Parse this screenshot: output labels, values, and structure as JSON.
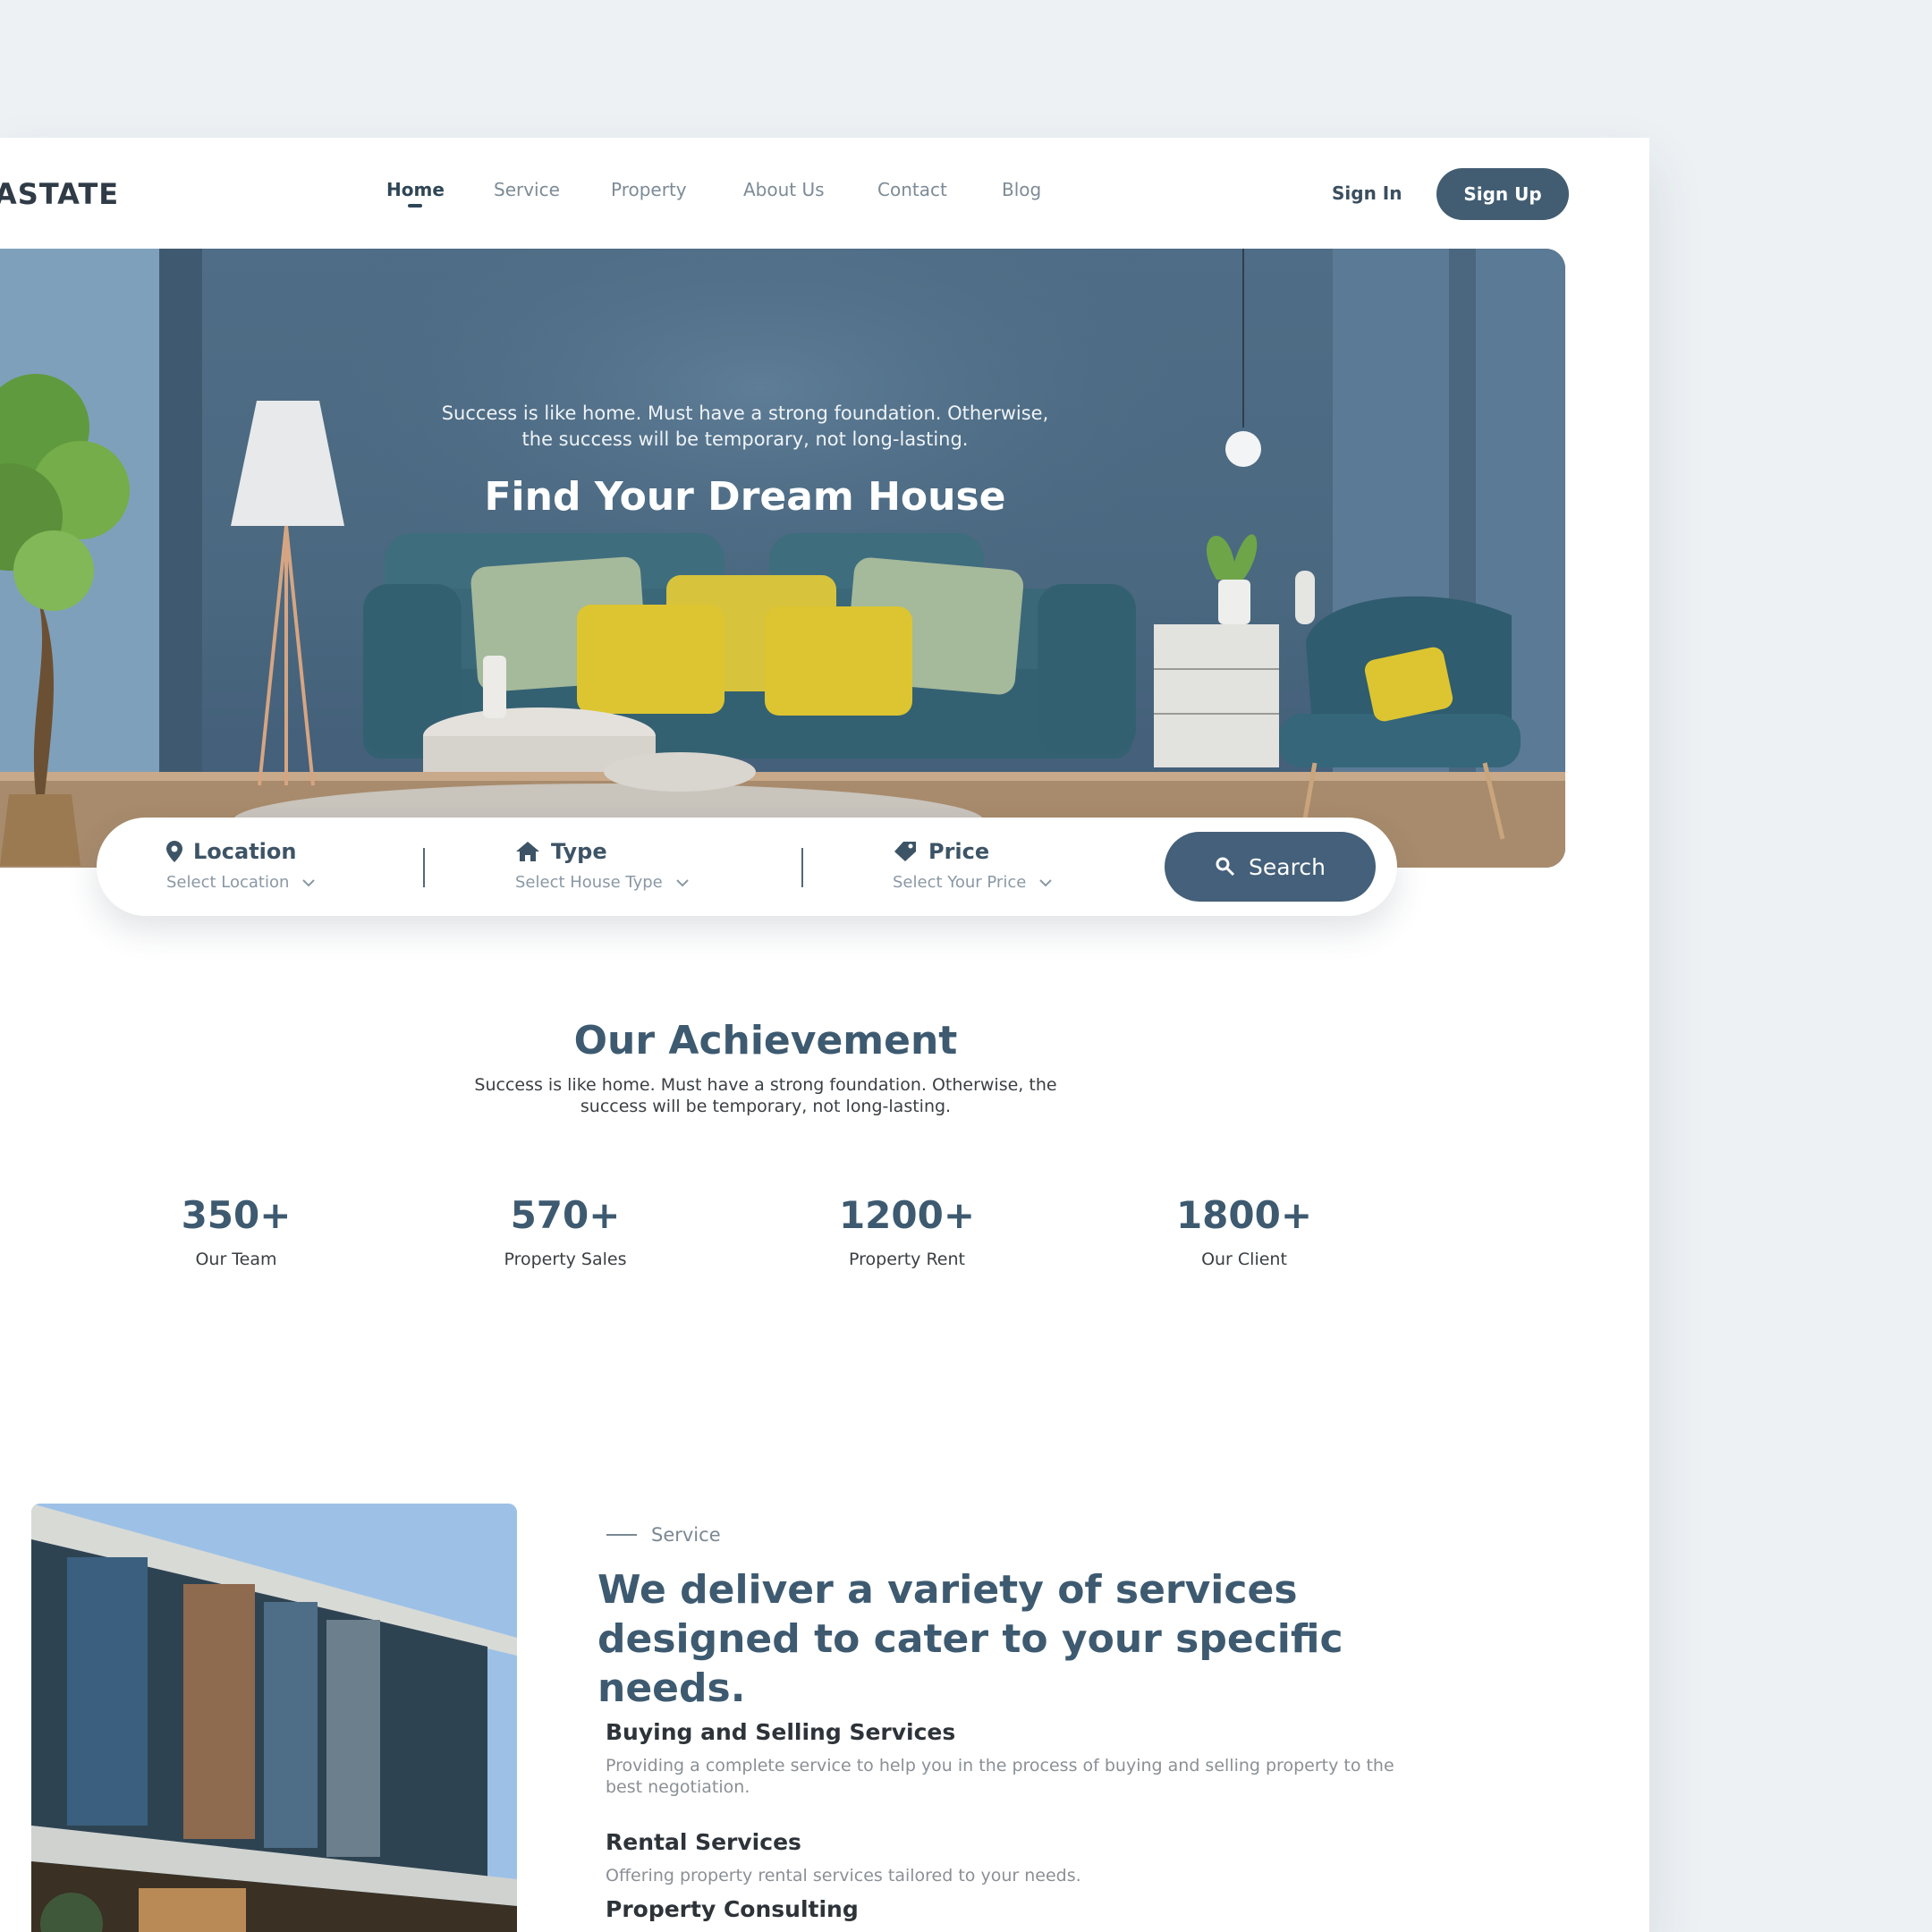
{
  "brand": {
    "logo_text": "ASTATE"
  },
  "nav": {
    "links": [
      "Home",
      "Service",
      "Property",
      "About Us",
      "Contact",
      "Blog"
    ],
    "active": "Home",
    "sign_in": "Sign In",
    "sign_up": "Sign Up"
  },
  "hero": {
    "title": "Find Your Dream House",
    "subtitle": "Success is like home. Must have a strong foundation. Otherwise, the success will be temporary, not long-lasting."
  },
  "search": {
    "location": {
      "label": "Location",
      "placeholder": "Select Location",
      "icon": "map-pin-icon"
    },
    "type": {
      "label": "Type",
      "placeholder": "Select House Type",
      "icon": "home-icon"
    },
    "price": {
      "label": "Price",
      "placeholder": "Select Your Price",
      "icon": "price-tag-icon"
    },
    "button": "Search"
  },
  "achievement": {
    "title": "Our Achievement",
    "subtitle": "Success is like home. Must have a strong foundation. Otherwise, the success will be temporary, not long-lasting.",
    "stats": [
      {
        "value": "350+",
        "label": "Our Team"
      },
      {
        "value": "570+",
        "label": "Property Sales"
      },
      {
        "value": "1200+",
        "label": "Property Rent"
      },
      {
        "value": "1800+",
        "label": "Our Client"
      }
    ]
  },
  "service": {
    "kicker": "Service",
    "title": "We deliver a variety of services designed to cater to your specific needs.",
    "items": [
      {
        "title": "Buying and Selling Services",
        "desc": "Providing a complete service to help you in the process of buying and selling property to the best negotiation."
      },
      {
        "title": "Rental Services",
        "desc": "Offering property rental services tailored to your needs."
      },
      {
        "title": "Property Consulting",
        "desc": ""
      }
    ]
  },
  "colors": {
    "primary": "#425d72",
    "heading": "#3d5a70",
    "background": "#edf1f4"
  }
}
